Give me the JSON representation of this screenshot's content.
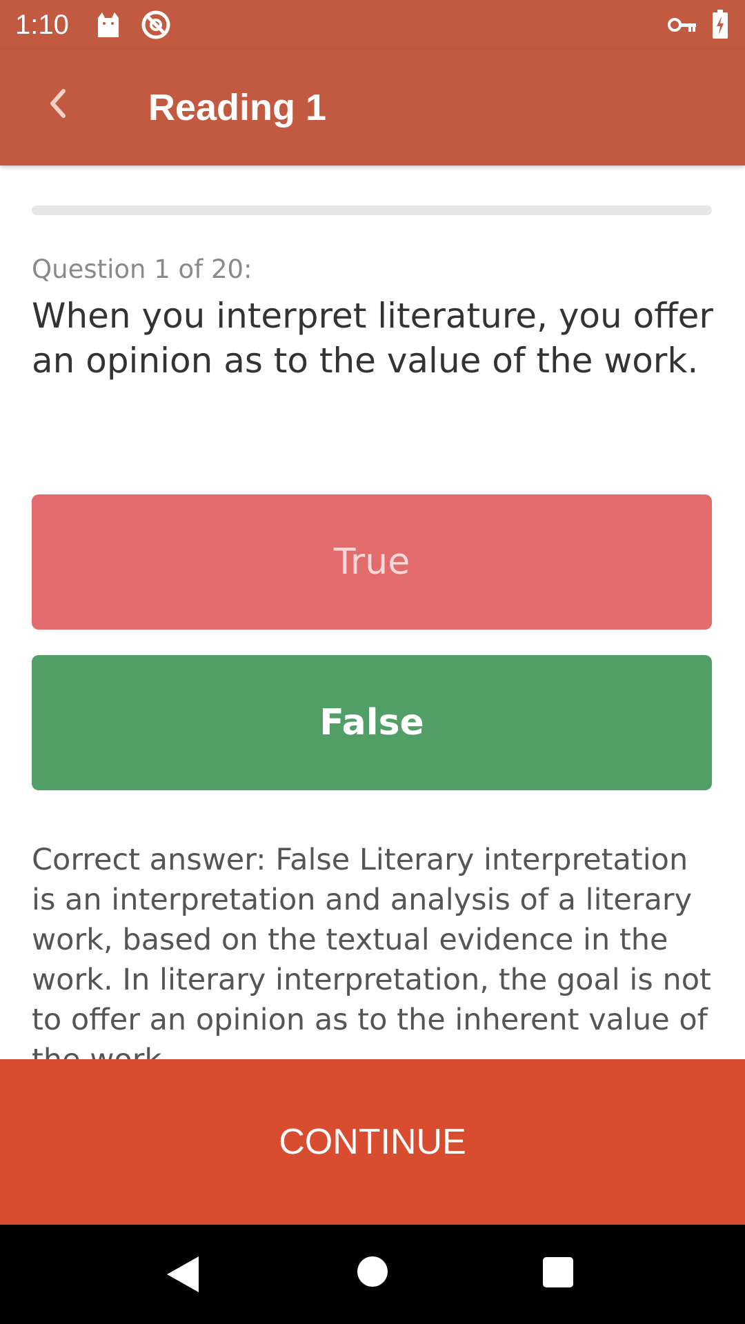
{
  "status_bar": {
    "time": "1:10",
    "icons": [
      "cat-icon",
      "blocked-icon",
      "vpn-key-icon",
      "battery-charging-icon"
    ]
  },
  "app_bar": {
    "back_icon": "chevron-left-icon",
    "title": "Reading 1"
  },
  "progress": {
    "fraction": 0.0
  },
  "question": {
    "counter": "Question 1 of 20:",
    "text": "When you interpret literature, you offer an opinion as to the value of the work."
  },
  "answers": [
    {
      "label": "True",
      "state": "incorrect",
      "color": "#e26b6b"
    },
    {
      "label": "False",
      "state": "correct",
      "color": "#519f66"
    }
  ],
  "explanation": "Correct answer: False Literary interpretation is an interpretation and analysis of a literary work, based on the textual evidence in the work. In literary interpretation, the goal is not to offer an opinion as to the inherent value of the work.",
  "continue_label": "CONTINUE",
  "colors": {
    "app_bar": "#c15a40",
    "continue": "#d84c2f",
    "nav_bar": "#000000"
  },
  "nav_bar": {
    "buttons": [
      "back-triangle-icon",
      "home-circle-icon",
      "recents-square-icon"
    ]
  }
}
